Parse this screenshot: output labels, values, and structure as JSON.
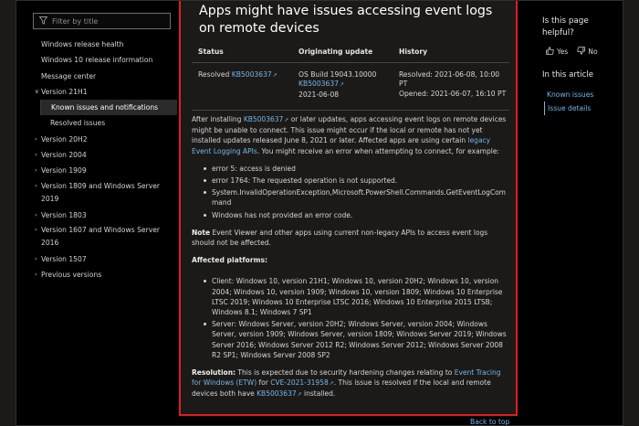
{
  "filter": {
    "placeholder": "Filter by title"
  },
  "nav": {
    "items": [
      {
        "label": "Windows release health"
      },
      {
        "label": "Windows 10 release information"
      },
      {
        "label": "Message center"
      },
      {
        "label": "Version 21H1",
        "expanded": true
      },
      {
        "label": "Known issues and notifications",
        "active": true
      },
      {
        "label": "Resolved issues"
      },
      {
        "label": "Version 20H2"
      },
      {
        "label": "Version 2004"
      },
      {
        "label": "Version 1909"
      },
      {
        "label": "Version 1809 and Windows Server 2019"
      },
      {
        "label": "Version 1803"
      },
      {
        "label": "Version 1607 and Windows Server 2016"
      },
      {
        "label": "Version 1507"
      },
      {
        "label": "Previous versions"
      }
    ]
  },
  "article": {
    "title": "Apps might have issues accessing event logs on remote devices",
    "table": {
      "headers": [
        "Status",
        "Originating update",
        "History"
      ],
      "status": "Resolved",
      "status_kb": "KB5003637",
      "origin_build": "OS Build 19043.10000",
      "origin_kb": "KB5003637",
      "origin_date": "2021-06-08",
      "history_resolved": "Resolved: 2021-06-08, 10:00 PT",
      "history_opened": "Opened: 2021-06-07, 16:10 PT"
    },
    "p1_before": "After installing ",
    "p1_kb": "KB5003637",
    "p1_middle": " or later updates, apps accessing event logs on remote devices might be unable to connect. This issue might occur if the local or remote has not yet installed updates released June 8, 2021 or later. Affected apps are using certain ",
    "p1_link": "legacy Event Logging APIs",
    "p1_after": ". You might receive an error when attempting to connect, for example:",
    "errors": [
      "error 5: access is denied",
      "error 1764: The requested operation is not supported.",
      "System.InvalidOperationException,Microsoft.PowerShell.Commands.GetEventLogCommand",
      "Windows has not provided an error code."
    ],
    "note_label": "Note",
    "note_text": " Event Viewer and other apps using current non-legacy APIs to access event logs should not be affected.",
    "affected_heading": "Affected platforms:",
    "platforms": [
      "Client: Windows 10, version 21H1; Windows 10, version 20H2; Windows 10, version 2004; Windows 10, version 1909; Windows 10, version 1809; Windows 10 Enterprise LTSC 2019; Windows 10 Enterprise LTSC 2016; Windows 10 Enterprise 2015 LTSB; Windows 8.1; Windows 7 SP1",
      "Server: Windows Server, version 20H2; Windows Server, version 2004; Windows Server, version 1909; Windows Server, version 1809; Windows Server 2019; Windows Server 2016; Windows Server 2012 R2; Windows Server 2012; Windows Server 2008 R2 SP1; Windows Server 2008 SP2"
    ],
    "resolution_label": "Resolution:",
    "resolution_text1": " This is expected due to security hardening changes relating to ",
    "resolution_link1": "Event Tracing for Windows (ETW)",
    "resolution_text2": " for ",
    "resolution_link2": "CVE-2021-31958",
    "resolution_text3": ". This issue is resolved if the local and remote devices both have ",
    "resolution_kb": "KB5003637",
    "resolution_text4": " installed.",
    "back_to_top": "Back to top"
  },
  "right": {
    "helpful": "Is this page helpful?",
    "yes": "Yes",
    "no": "No",
    "in_article": "In this article",
    "toc": [
      "Known issues",
      "Issue details"
    ]
  },
  "colors": {
    "accent": "#75b6e7",
    "highlight_box": "#e11b22",
    "background": "#1b1a19"
  }
}
